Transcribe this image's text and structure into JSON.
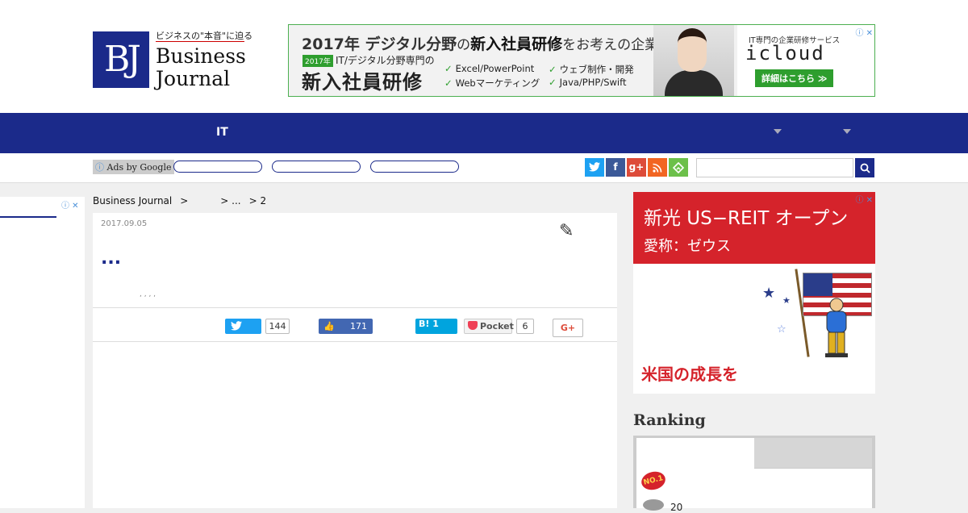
{
  "logo": {
    "tagline": "ビジネスの\"本音\"に迫る",
    "mark": "BJ",
    "word1": "Business",
    "word2": "Journal"
  },
  "top_ad": {
    "headline_year": "2017年",
    "headline_a": " デジタル分野",
    "headline_b": "の",
    "headline_c": "新入社員研修",
    "headline_d": "をお考えの企業さま",
    "badge": "2017年",
    "sub": "IT/デジタル分野専門の",
    "big": "新入社員研修",
    "checks": [
      "Excel/PowerPoint",
      "ウェブ制作・開発",
      "Webマーケティング",
      "Java/PHP/Swift"
    ],
    "service": "IT専門の企業研修サービス",
    "brand": "icloud",
    "cta": "詳細はこちら ≫",
    "close": "ⓘ ✕"
  },
  "nav": {
    "item_it": "IT"
  },
  "subbar": {
    "ads_by": "Ads by Google",
    "info": "ⓘ",
    "search_icon": "search-icon"
  },
  "left_ad": {
    "close": "ⓘ ✕"
  },
  "breadcrumb": {
    "home": "Business Journal",
    "sep1": ">",
    "sep2": "> ...",
    "page": "> 2"
  },
  "article": {
    "date": "2017.09.05",
    "title": "...",
    "tags": ", , , ,",
    "share": {
      "twitter_count": "144",
      "like_count": "171",
      "hatena_label": "B! 1",
      "pocket_label": "Pocket",
      "pocket_count": "6",
      "gplus_label": "G+"
    }
  },
  "right_ad": {
    "line1": "新光 US−REIT オープン",
    "line2": "愛称：ゼウス",
    "bottom": "米国の成長を",
    "close": "ⓘ ✕"
  },
  "ranking": {
    "title": "Ranking",
    "badge1": "NO.1",
    "entry2_prefix": "20"
  },
  "colors": {
    "navy": "#1b2a8a",
    "green": "#2e9e2e",
    "red": "#d5232b"
  }
}
